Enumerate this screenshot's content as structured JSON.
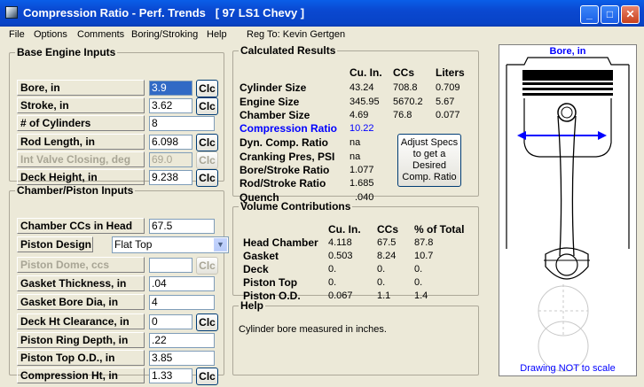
{
  "window": {
    "title": "Compression Ratio - Perf. Trends   [ 97 LS1 Chevy ]"
  },
  "titlebar_buttons": {
    "minimize": "_",
    "maximize": "□",
    "close": "✕"
  },
  "menu": {
    "items": [
      "File",
      "Options",
      "Comments",
      "Boring/Stroking",
      "Help"
    ],
    "reg": "Reg To: Kevin Gertgen"
  },
  "base_engine": {
    "title": "Base Engine Inputs",
    "rows": [
      {
        "label": "Bore, in",
        "value": "3.9",
        "clc": "Clc"
      },
      {
        "label": "Stroke, in",
        "value": "3.62",
        "clc": "Clc"
      },
      {
        "label": "# of Cylinders",
        "value": "8"
      },
      {
        "label": "Rod Length, in",
        "value": "6.098",
        "clc": "Clc"
      },
      {
        "label": "Int Valve Closing, deg",
        "value": "69.0",
        "clc": "Clc"
      },
      {
        "label": "Deck Height, in",
        "value": "9.238",
        "clc": "Clc"
      }
    ]
  },
  "chamber": {
    "title": "Chamber/Piston Inputs",
    "rows": [
      {
        "label": "Chamber CCs in Head",
        "value": "67.5"
      },
      {
        "label": "Piston Design",
        "select_value": "Flat Top"
      },
      {
        "label": "Piston Dome, ccs",
        "value": "",
        "clc": "Clc"
      },
      {
        "label": "Gasket Thickness, in",
        "value": ".04"
      },
      {
        "label": "Gasket Bore Dia, in",
        "value": "4"
      },
      {
        "label": "Deck Ht Clearance, in",
        "value": "0",
        "clc": "Clc"
      },
      {
        "label": "Piston Ring Depth, in",
        "value": ".22"
      },
      {
        "label": "Piston Top O.D., in",
        "value": "3.85"
      },
      {
        "label": "Compression Ht, in",
        "value": "1.33",
        "clc": "Clc"
      }
    ]
  },
  "calculated": {
    "title": "Calculated Results",
    "headers": [
      "Cu. In.",
      "CCs",
      "Liters"
    ],
    "rows": [
      {
        "label": "Cylinder Size",
        "cu": "43.24",
        "cc": "708.8",
        "l": "0.709"
      },
      {
        "label": "Engine Size",
        "cu": "345.95",
        "cc": "5670.2",
        "l": "5.67"
      },
      {
        "label": "Chamber Size",
        "cu": "4.69",
        "cc": "76.8",
        "l": "0.077"
      },
      {
        "label": "Compression Ratio",
        "cu": "10.22"
      },
      {
        "label": "Dyn. Comp. Ratio",
        "cu": "na"
      },
      {
        "label": "Cranking Pres, PSI",
        "cu": "na"
      },
      {
        "label": "Bore/Stroke Ratio",
        "cu": "1.077"
      },
      {
        "label": "Rod/Stroke Ratio",
        "cu": "1.685"
      },
      {
        "label": "Quench",
        "cu": ".040"
      }
    ],
    "adjust_button": [
      "Adjust Specs",
      "to get a",
      "Desired",
      "Comp. Ratio"
    ],
    "highlight_color": "#0000ff"
  },
  "volume": {
    "title": "Volume Contributions",
    "headers": [
      "Cu. In.",
      "CCs",
      "% of Total"
    ],
    "rows": [
      {
        "label": "Head Chamber",
        "cu": "4.118",
        "cc": "67.5",
        "pct": "87.8"
      },
      {
        "label": "Gasket",
        "cu": "0.503",
        "cc": "8.24",
        "pct": "10.7"
      },
      {
        "label": "Deck",
        "cu": "0.",
        "cc": "0.",
        "pct": "0."
      },
      {
        "label": "Piston Top",
        "cu": "0.",
        "cc": "0.",
        "pct": "0."
      },
      {
        "label": "Piston O.D.",
        "cu": "0.067",
        "cc": "1.1",
        "pct": "1.4"
      }
    ]
  },
  "help": {
    "title": "Help",
    "text": "Cylinder bore measured in inches."
  },
  "drawing": {
    "title": "Bore, in",
    "footer": "Drawing NOT to scale",
    "accent": "#0000ff"
  }
}
